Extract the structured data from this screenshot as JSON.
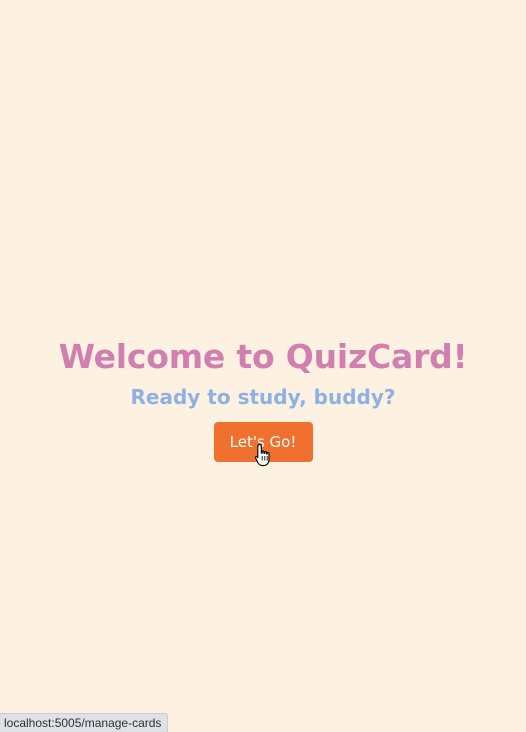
{
  "hero": {
    "title": "Welcome to QuizCard!",
    "subtitle": "Ready to study, buddy?",
    "button_label": "Let's Go!"
  },
  "status_bar": {
    "url": "localhost:5005/manage-cards"
  },
  "colors": {
    "background": "#fdf2e2",
    "title": "#d17fb0",
    "subtitle": "#8fb0e2",
    "button": "#f07030"
  },
  "icons": {
    "cursor": "hand-pointer-icon"
  }
}
